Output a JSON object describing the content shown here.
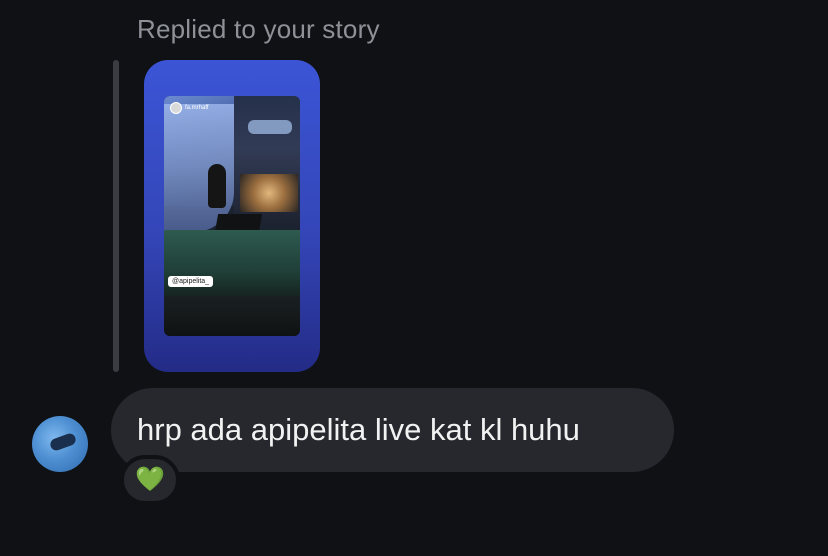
{
  "reply_context": {
    "label": "Replied to your story"
  },
  "story_preview": {
    "username": "fa.mrhaff",
    "mention_sticker": "@apipelita_"
  },
  "message": {
    "text": "hrp ada apipelita live kat kl huhu"
  },
  "reaction": {
    "emoji": "💚"
  },
  "colors": {
    "background": "#0f1115",
    "bubble": "#26282d",
    "story_card_gradient_top": "#3b55d6",
    "story_card_gradient_bottom": "#232b86",
    "muted_text": "#8e9197"
  },
  "icons": {
    "sender_avatar": "profile-avatar",
    "reaction": "green-heart-icon"
  }
}
